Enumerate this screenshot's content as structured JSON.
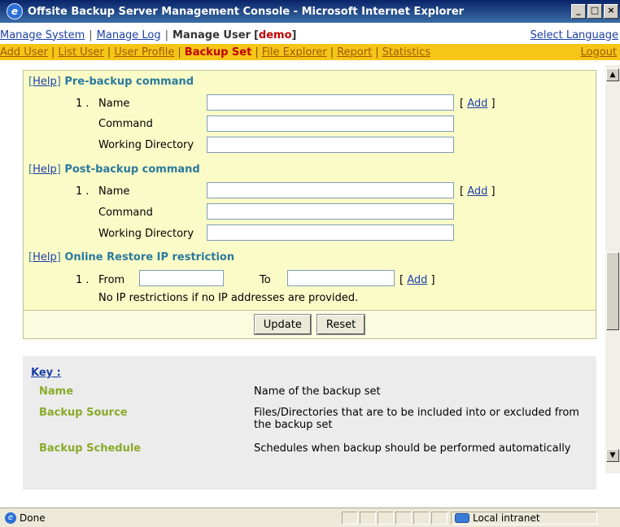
{
  "window": {
    "title": "Offsite Backup Server Management Console - Microsoft Internet Explorer",
    "app_icon": "ie-icon",
    "buttons": {
      "minimize": "_",
      "maximize": "□",
      "close": "×"
    }
  },
  "nav1": {
    "manage_system": "Manage System",
    "manage_log": "Manage Log",
    "manage_user": "Manage User",
    "user_open": "[",
    "user": "demo",
    "user_close": "]",
    "select_language": "Select Language",
    "separator": "|"
  },
  "nav2": {
    "add_user": "Add User",
    "list_user": "List User",
    "user_profile": "User Profile",
    "backup_set": "Backup Set",
    "file_explorer": "File Explorer",
    "report": "Report",
    "statistics": "Statistics",
    "logout": "Logout",
    "separator": "|"
  },
  "pre_backup": {
    "help": "Help",
    "title": "Pre-backup command",
    "index": "1 .",
    "name_label": "Name",
    "command_label": "Command",
    "working_dir_label": "Working Directory",
    "add": "Add"
  },
  "post_backup": {
    "help": "Help",
    "title": "Post-backup command",
    "index": "1 .",
    "name_label": "Name",
    "command_label": "Command",
    "working_dir_label": "Working Directory",
    "add": "Add"
  },
  "ip_restriction": {
    "help": "Help",
    "title": "Online Restore IP restriction",
    "index": "1 .",
    "from_label": "From",
    "to_label": "To",
    "add": "Add",
    "note": "No IP restrictions if no IP addresses are provided."
  },
  "form_buttons": {
    "update": "Update",
    "reset": "Reset"
  },
  "bracket_open": "[",
  "bracket_close": "]",
  "key": {
    "title": "Key :",
    "rows": [
      {
        "name": "Name",
        "desc": "Name of the backup set"
      },
      {
        "name": "Backup Source",
        "desc": "Files/Directories that are to be included into or excluded from the backup set"
      },
      {
        "name": "Backup Schedule",
        "desc": "Schedules when backup should be performed automatically"
      }
    ]
  },
  "status": {
    "text": "Done",
    "zone": "Local intranet"
  },
  "colors": {
    "accent_yellow": "#f5c518",
    "panel_bg": "#fbfbc8",
    "heading_teal": "#2a7a9c",
    "key_green": "#8aaa2a",
    "link_blue": "#1a3fa8"
  }
}
